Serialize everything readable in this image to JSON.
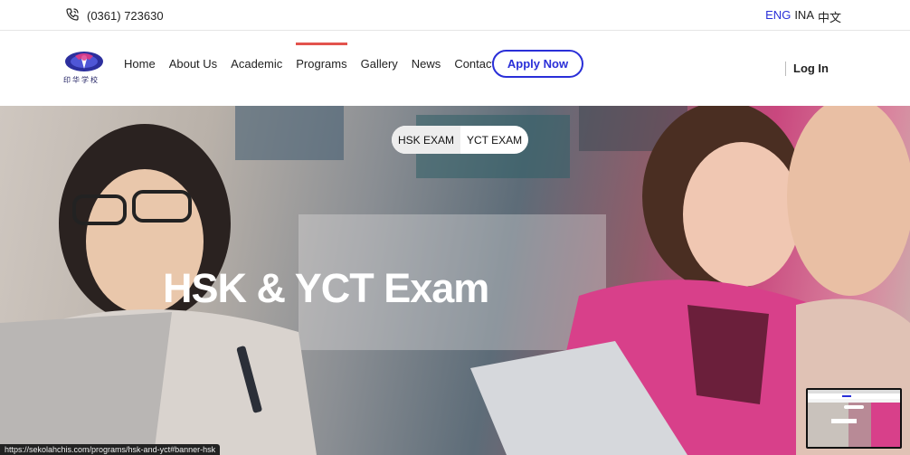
{
  "topbar": {
    "phone_icon": "phone-icon",
    "phone": "(0361) 723630",
    "languages": [
      {
        "label": "ENG",
        "active": true
      },
      {
        "label": "INA",
        "active": false
      },
      {
        "label": "中文",
        "active": false
      }
    ]
  },
  "nav": {
    "logo_text": "印华学校",
    "items": [
      "Home",
      "About Us",
      "Academic",
      "Programs",
      "Gallery",
      "News",
      "Contact Us"
    ],
    "active_item": "Programs",
    "apply_label": "Apply Now",
    "login_label": "Log In"
  },
  "hero": {
    "tabs": [
      {
        "label": "HSK EXAM",
        "active": true
      },
      {
        "label": "YCT EXAM",
        "active": false
      }
    ],
    "title": "HSK & YCT Exam"
  },
  "status_bar": {
    "url": "https://sekolahchis.com/programs/hsk-and-yct#banner-hsk"
  },
  "colors": {
    "accent_blue": "#2a2fd8",
    "active_underline": "#e3534d",
    "hero_title": "#ffffff"
  }
}
